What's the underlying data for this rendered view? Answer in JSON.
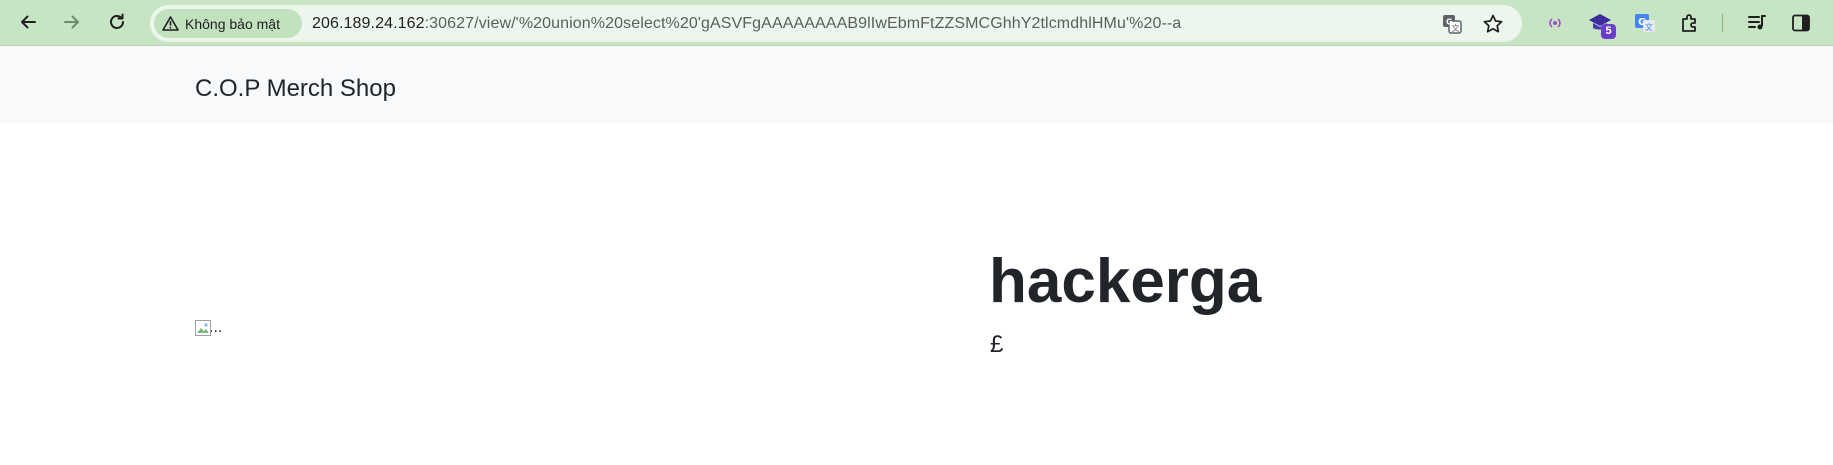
{
  "browser": {
    "security_label": "Không bảo mật",
    "url_host": "206.189.24.162",
    "url_rest": ":30627/view/'%20union%20select%20'gASVFgAAAAAAAAB9lIwEbmFtZZSMCGhhY2tlcmdhlHMu'%20--a",
    "extensions": [
      {
        "name": "podcast-extension-icon"
      },
      {
        "name": "mortarboard-extension-icon",
        "badge": "5"
      },
      {
        "name": "google-translate-extension-icon"
      }
    ],
    "colors": {
      "toolbar": "#c7e5c5",
      "omnibox": "#edf6ec",
      "badge": "#6a3fc7"
    }
  },
  "page": {
    "brand": "C.O.P Merch Shop",
    "image_alt": "...",
    "product_title": "hackerga",
    "price": "£"
  }
}
